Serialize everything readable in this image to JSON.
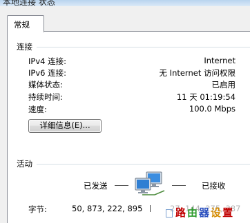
{
  "window": {
    "title": "本地连接 状态"
  },
  "tabs": [
    {
      "label": "常规"
    }
  ],
  "connection": {
    "section_label": "连接",
    "rows": [
      {
        "label": "IPv4 连接:",
        "value": "Internet"
      },
      {
        "label": "IPv6 连接:",
        "value": "无 Internet 访问权限"
      },
      {
        "label": "媒体状态:",
        "value": "已启用"
      },
      {
        "label": "持续时间:",
        "value": "11 天 01:19:54"
      },
      {
        "label": "速度:",
        "value": "100.0 Mbps"
      }
    ],
    "details_button": "详细信息(E)..."
  },
  "activity": {
    "section_label": "活动",
    "sent_label": "已发送",
    "received_label": "已接收",
    "bytes_label": "字节:",
    "bytes_sent": "50, 873, 222, 895",
    "bytes_received": "27, 144, 275, 387",
    "icon": "network-computers-icon"
  },
  "watermark": {
    "text": "路由器设置",
    "colors": [
      "#c00000",
      "#2a9a2a",
      "#2a4fbf",
      "#d48a00"
    ]
  }
}
